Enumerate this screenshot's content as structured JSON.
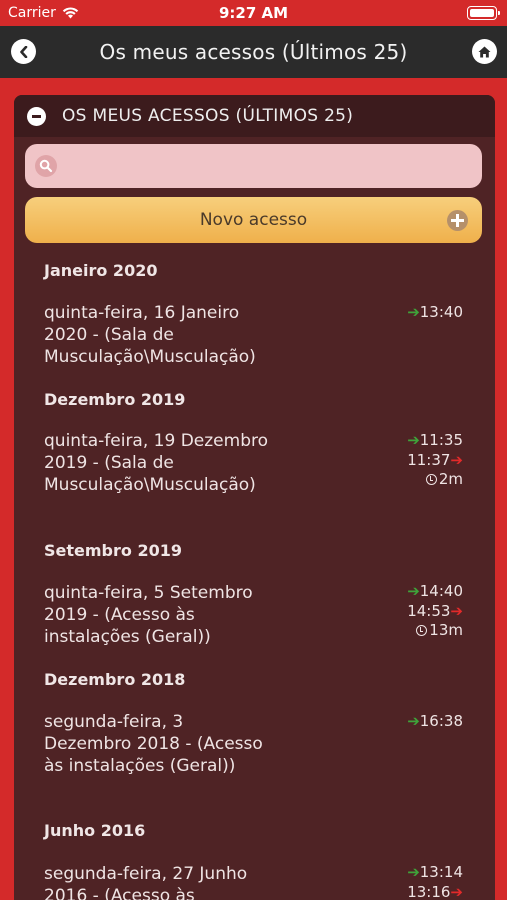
{
  "status": {
    "carrier": "Carrier",
    "time": "9:27 AM"
  },
  "nav": {
    "title": "Os meus acessos (Últimos 25)"
  },
  "panel": {
    "title": "OS MEUS ACESSOS (ÚLTIMOS 25)"
  },
  "search": {
    "placeholder": "",
    "value": ""
  },
  "new_button": {
    "label": "Novo acesso"
  },
  "groups": [
    {
      "month": "Janeiro 2020",
      "entries": [
        {
          "text": "quinta-feira, 16 Janeiro 2020 - (Sala de Musculação\\Musculação)",
          "in": "13:40",
          "out": "",
          "duration": ""
        }
      ]
    },
    {
      "month": "Dezembro 2019",
      "entries": [
        {
          "text": "quinta-feira, 19 Dezembro 2019 - (Sala de Musculação\\Musculação)",
          "in": "11:35",
          "out": "11:37",
          "duration": "2m"
        }
      ]
    },
    {
      "month": "Setembro 2019",
      "entries": [
        {
          "text": "quinta-feira, 5 Setembro 2019 - (Acesso às instalações (Geral))",
          "in": "14:40",
          "out": "14:53",
          "duration": "13m"
        }
      ]
    },
    {
      "month": "Dezembro 2018",
      "entries": [
        {
          "text": "segunda-feira, 3 Dezembro 2018 - (Acesso às instalações (Geral))",
          "in": "16:38",
          "out": "",
          "duration": ""
        }
      ]
    },
    {
      "month": "Junho 2016",
      "entries": [
        {
          "text": "segunda-feira, 27 Junho 2016 - (Acesso às",
          "in": "13:14",
          "out": "13:16",
          "duration": ""
        }
      ]
    }
  ],
  "colors": {
    "background": "#d42a2a",
    "nav": "#2b2b2b",
    "panel": "#4f2325",
    "arrow_in": "#3fa33a",
    "arrow_out": "#e22a2a",
    "button": "#f2bd5e"
  },
  "icons": {
    "back": "chevron-left-icon",
    "home": "home-icon",
    "collapse": "minus-circle-icon",
    "search": "search-icon",
    "add": "plus-circle-icon",
    "wifi": "wifi-icon",
    "battery": "battery-icon"
  }
}
